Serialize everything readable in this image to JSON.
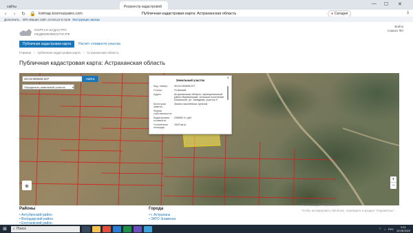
{
  "browser": {
    "tabs": [
      "сайты",
      "",
      "",
      "",
      "",
      "",
      "",
      "",
      "",
      "Росреестр кадастровой"
    ],
    "url": "kotmap.kosmozpates.com",
    "page_title": "Публичная кадастровая карта: Астраханская область",
    "yandex_button": "Сегодня",
    "bookmarks_text": "Дополнить · 40% Ваших сайт. остаться в поле",
    "bookmarks_highlight": "Инструкции заказы"
  },
  "site": {
    "logo_line1": "ПОРТАЛ КАДАСТРА",
    "logo_line2": "НЕДВИЖИМОСТИ.РФ",
    "account_line1": "Войти",
    "account_line2": "Самсат ФЛ"
  },
  "nav": {
    "primary": "Публичная кадастровая карта",
    "secondary": "Расчёт стоимости участка"
  },
  "breadcrumbs": [
    "Главная",
    "публичная кадастровая карта",
    "Астраханская область"
  ],
  "page_heading": "Публичная кадастровая карта: Астраханская область",
  "map": {
    "search_value": "30:04:050606:207",
    "search_button": "Найти",
    "layer_select": "Определить земельный участок",
    "layer_icon": "layers-icon",
    "zoom_in": "+",
    "zoom_out": "−"
  },
  "popup": {
    "title": "Земельный участок",
    "close": "×",
    "rows": [
      {
        "k": "Кад. номер:",
        "v": "30:04:050606:207"
      },
      {
        "k": "Статус:",
        "v": "Учтённый"
      },
      {
        "k": "Адрес:",
        "v": "Астраханская область, муниципальный район Икрянинский, сельское поселение Ильинское, ул. Западная, участок 9"
      },
      {
        "k": "Категория земель:",
        "v": "Земли населённых пунктов"
      },
      {
        "k": "Форма собственности:",
        "v": ""
      },
      {
        "k": "Кадастровая стоимость:",
        "v": "245650 тг. руб."
      },
      {
        "k": "Уточнённая площадь:",
        "v": "1000 кв.м"
      }
    ]
  },
  "regions": {
    "heading": "Районы",
    "items": [
      "Ахтубинский район",
      "Володарский район",
      "Енотаевский район"
    ]
  },
  "cities": {
    "heading": "Города",
    "items": [
      "г. Астрахань",
      "ЗАТО Знаменск"
    ]
  },
  "windows_activation": {
    "line1": "Активация Windows",
    "line2": "Чтобы активировать Windows, перейдите в раздел \"Параметры\"."
  },
  "taskbar": {
    "search_placeholder": "Поиск",
    "time": "9:11",
    "date": "12.08.2022",
    "lang": "РУС"
  }
}
